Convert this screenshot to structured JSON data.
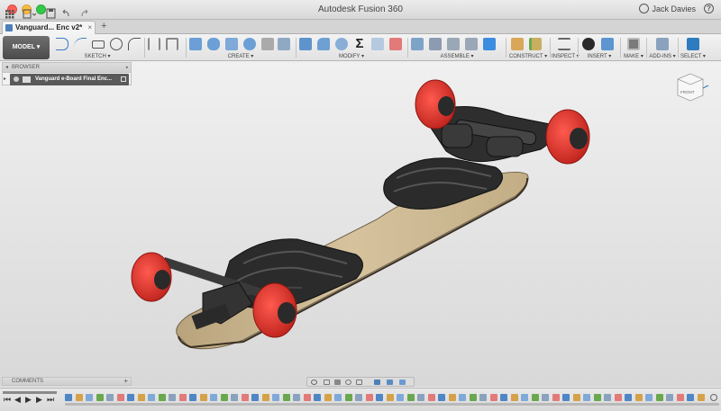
{
  "app": {
    "title": "Autodesk Fusion 360",
    "user": "Jack Davies"
  },
  "tabs": [
    {
      "label": "Vanguard... Enc v2*",
      "close": "×"
    }
  ],
  "new_tab": "+",
  "workspace": {
    "label": "MODEL ▾"
  },
  "toolbar_groups": [
    {
      "label": "SKETCH ▾"
    },
    {
      "label": "CREATE ▾"
    },
    {
      "label": "MODIFY ▾"
    },
    {
      "label": "ASSEMBLE ▾"
    },
    {
      "label": "CONSTRUCT ▾"
    },
    {
      "label": "INSPECT ▾"
    },
    {
      "label": "INSERT ▾"
    },
    {
      "label": "MAKE ▾"
    },
    {
      "label": "ADD-INS ▾"
    },
    {
      "label": "SELECT ▾"
    }
  ],
  "browser": {
    "title": "BROWSER",
    "root_item": "Vanguard e-Board Final Enc..."
  },
  "comments": {
    "title": "COMMENTS"
  },
  "viewcube": {
    "label": "FRONT"
  },
  "colors": {
    "wheel": "#e8302a",
    "deck": "#c8b38c",
    "enclosure": "#2b2b2b",
    "truck": "#3a3a3a",
    "accent": "#2f7bbf"
  }
}
